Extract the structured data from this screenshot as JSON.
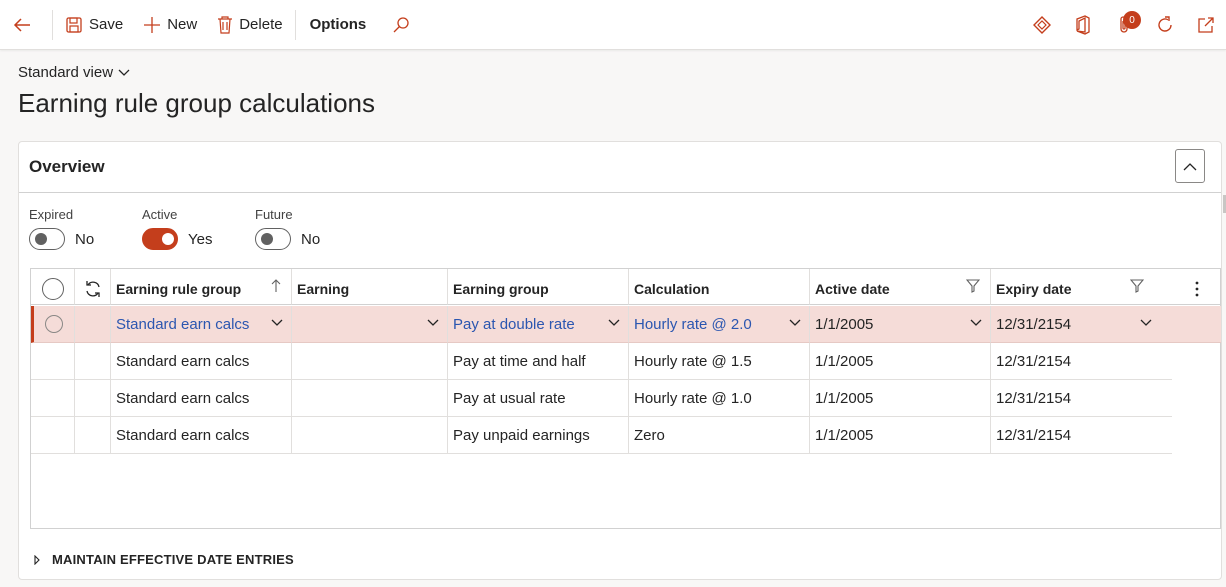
{
  "toolbar": {
    "save_label": "Save",
    "new_label": "New",
    "delete_label": "Delete",
    "options_label": "Options",
    "notification_count": "0"
  },
  "header": {
    "view_label": "Standard view",
    "title": "Earning rule group calculations"
  },
  "overview": {
    "title": "Overview",
    "toggles": [
      {
        "label": "Expired",
        "value": "No",
        "on": false
      },
      {
        "label": "Active",
        "value": "Yes",
        "on": true
      },
      {
        "label": "Future",
        "value": "No",
        "on": false
      }
    ]
  },
  "grid": {
    "columns": [
      "Earning rule group",
      "Earning",
      "Earning group",
      "Calculation",
      "Active date",
      "Expiry date"
    ],
    "rows": [
      {
        "earning_rule_group": "Standard earn calcs",
        "earning": "",
        "earning_group": "Pay at double rate",
        "calculation": "Hourly rate @ 2.0",
        "active_date": "1/1/2005",
        "expiry_date": "12/31/2154"
      },
      {
        "earning_rule_group": "Standard earn calcs",
        "earning": "",
        "earning_group": "Pay at time and half",
        "calculation": "Hourly rate @ 1.5",
        "active_date": "1/1/2005",
        "expiry_date": "12/31/2154"
      },
      {
        "earning_rule_group": "Standard earn calcs",
        "earning": "",
        "earning_group": "Pay at usual rate",
        "calculation": "Hourly rate @ 1.0",
        "active_date": "1/1/2005",
        "expiry_date": "12/31/2154"
      },
      {
        "earning_rule_group": "Standard earn calcs",
        "earning": "",
        "earning_group": "Pay unpaid earnings",
        "calculation": "Zero",
        "active_date": "1/1/2005",
        "expiry_date": "12/31/2154"
      }
    ]
  },
  "footer": {
    "section_label": "MAINTAIN EFFECTIVE DATE ENTRIES"
  },
  "colors": {
    "accent": "#c43e1c",
    "link": "#2b56b0",
    "selected_row": "#f5dcd8"
  }
}
